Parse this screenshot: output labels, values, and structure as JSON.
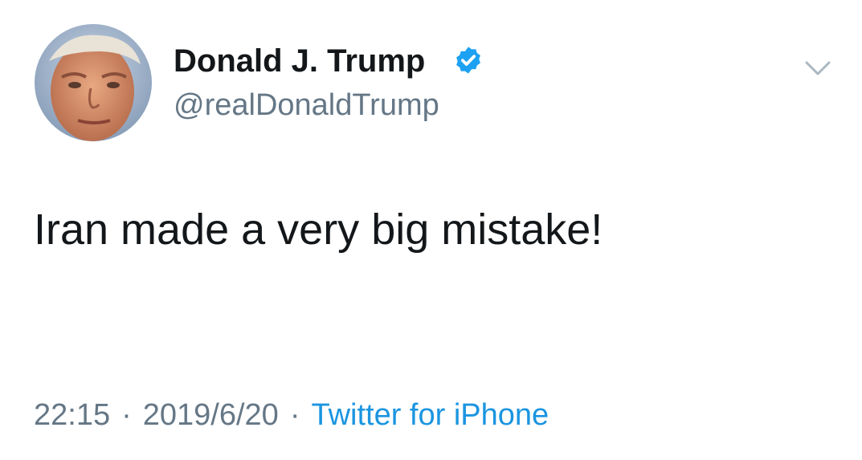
{
  "author": {
    "display_name": "Donald J. Trump",
    "handle": "@realDonaldTrump",
    "verified": true,
    "avatar_icon": "profile-photo"
  },
  "tweet": {
    "text": "Iran made a very big mistake!"
  },
  "meta": {
    "time": "22:15",
    "separator": "·",
    "date": "2019/6/20",
    "source": "Twitter for iPhone"
  },
  "colors": {
    "text": "#14171a",
    "secondary": "#657786",
    "link": "#1b95e0",
    "verified_badge": "#1da1f2",
    "background": "#ffffff"
  },
  "icons": {
    "verified": "verified-badge-icon",
    "menu": "chevron-down-icon"
  }
}
